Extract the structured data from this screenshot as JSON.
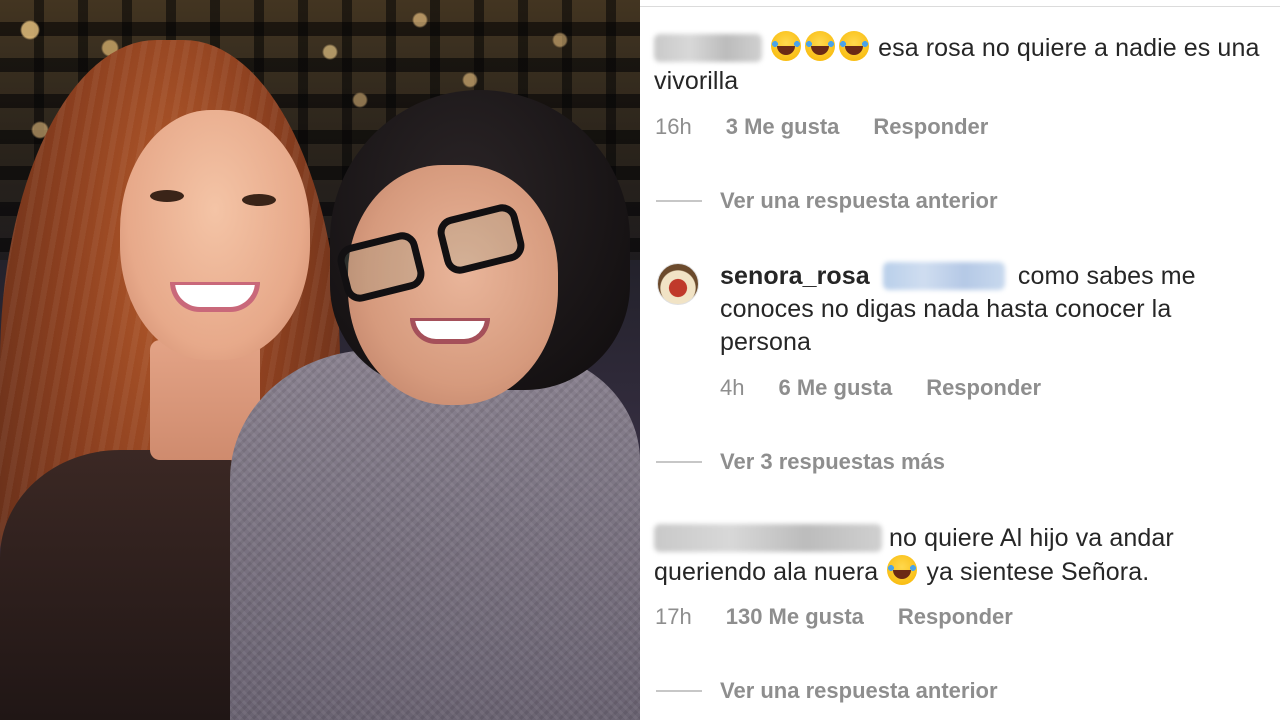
{
  "comments": [
    {
      "author_hidden": true,
      "text": "esa rosa  no quiere a nadie es una vivorilla",
      "time": "16h",
      "likes": "3 Me gusta",
      "reply_label": "Responder",
      "thread_link": "Ver una respuesta anterior"
    },
    {
      "author": "senora_rosa",
      "mention_hidden": true,
      "text": "como sabes me conoces no digas nada hasta conocer la persona",
      "time": "4h",
      "likes": "6 Me gusta",
      "reply_label": "Responder",
      "thread_link": "Ver 3 respuestas más"
    },
    {
      "author_hidden": true,
      "text_part1": "no quiere Al hijo va andar queriendo ala nuera",
      "text_part2": "ya sientese Señora.",
      "time": "17h",
      "likes": "130 Me gusta",
      "reply_label": "Responder",
      "thread_link": "Ver una respuesta anterior"
    }
  ],
  "icons": {
    "laugh_emoji": "face-with-tears-of-joy-icon",
    "avatar": "senora-rosa-avatar"
  },
  "colors": {
    "meta_gray": "#8e8e8e",
    "text": "#262626"
  }
}
